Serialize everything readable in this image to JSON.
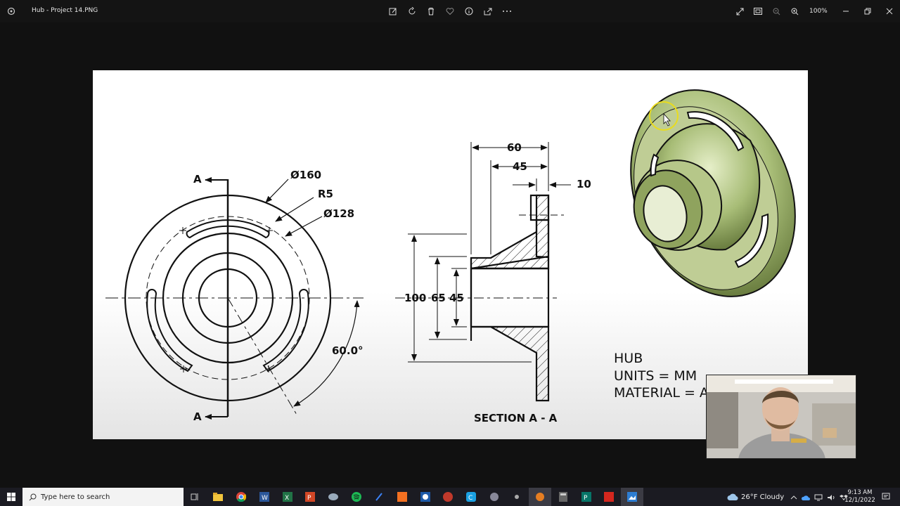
{
  "window": {
    "title": "Hub - Project 14.PNG",
    "zoom": "100%"
  },
  "icons": {
    "app": "photos-app-icon",
    "toolbar": [
      "edit-image-icon",
      "rotate-icon",
      "delete-icon",
      "favorite-icon",
      "info-icon",
      "share-icon",
      "more-icon"
    ],
    "right": [
      "fullscreen-icon",
      "fit-icon",
      "zoom-out-icon",
      "zoom-in-icon"
    ],
    "window_controls": [
      "minimize-icon",
      "restore-icon",
      "close-icon"
    ]
  },
  "drawing": {
    "front_view": {
      "section_mark_top": "A",
      "section_mark_bottom": "A",
      "dim_diameter_outer": "Ø160",
      "dim_radius": "R5",
      "dim_diameter_bolt": "Ø128",
      "dim_angle": "60.0°"
    },
    "section_view": {
      "dim_60": "60",
      "dim_45_top": "45",
      "dim_10": "10",
      "dim_100": "100",
      "dim_65": "65",
      "dim_45_left": "45",
      "caption": "SECTION A - A"
    },
    "info": {
      "name": "HUB",
      "units": "UNITS = MM",
      "material": "MATERIAL = A"
    }
  },
  "taskbar": {
    "search_placeholder": "Type here to search",
    "apps": [
      "task-view-icon",
      "file-explorer-icon",
      "chrome-icon",
      "word-icon",
      "excel-icon",
      "powerpoint-icon",
      "app-icon",
      "spotify-icon",
      "app-icon",
      "app-icon",
      "app-icon",
      "app-icon",
      "app-icon",
      "app-icon",
      "app-icon",
      "app-icon",
      "calculator-icon",
      "publisher-icon",
      "acrobat-icon",
      "photos-icon"
    ],
    "weather": "26°F  Cloudy",
    "time": "9:13 AM",
    "date": "12/1/2022"
  }
}
